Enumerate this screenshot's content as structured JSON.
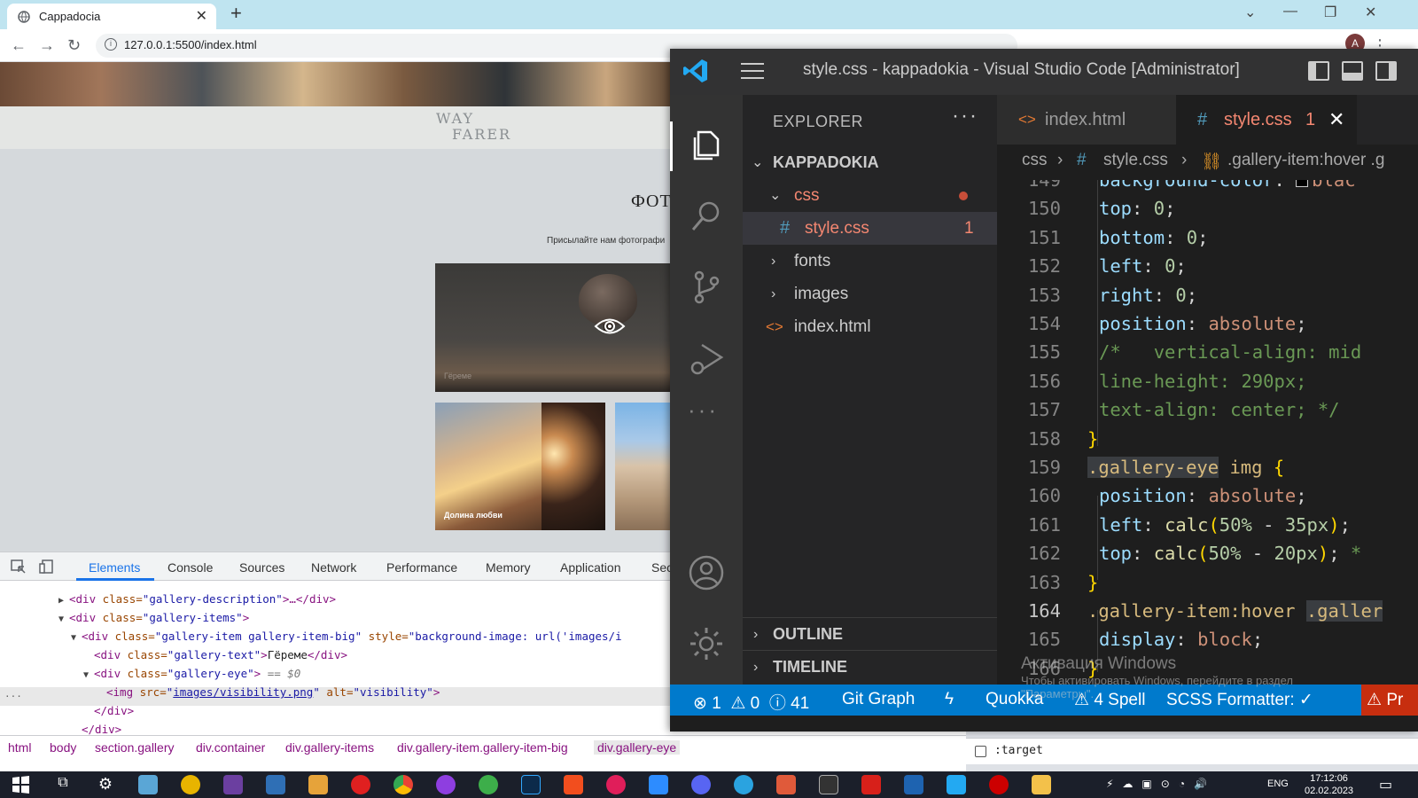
{
  "browser": {
    "tab_title": "Cappadocia",
    "url": "127.0.0.1:5500/index.html"
  },
  "webpage": {
    "logo_line1": "WAY",
    "logo_line2": "FARER",
    "gallery_title": "ФОТ",
    "gallery_description": "Присылайте нам фотографи",
    "big_image_caption": "Гёреме",
    "small_image1_caption": "Долина любви"
  },
  "devtools": {
    "tabs": [
      "Elements",
      "Console",
      "Sources",
      "Network",
      "Performance",
      "Memory",
      "Application",
      "Sec"
    ],
    "active_tab": "Elements",
    "dom": {
      "l1_tag_open": "<div",
      "l1_attr": " class=",
      "l1_val": "\"gallery-description\"",
      "l1_rest": ">…</div>",
      "l2_tag_open": "<div",
      "l2_attr": " class=",
      "l2_val": "\"gallery-items\"",
      "l2_rest": ">",
      "l3_tag_open": "<div",
      "l3_attr": " class=",
      "l3_val": "\"gallery-item gallery-item-big\"",
      "l3_attr2": " style=",
      "l3_val2": "\"background-image: url('images/i",
      "l4_tag_open": "<div",
      "l4_attr": " class=",
      "l4_val": "\"gallery-text\"",
      "l4_gt": ">",
      "l4_text": "Гёреме",
      "l4_close": "</div>",
      "l5_tag_open": "<div",
      "l5_attr": " class=",
      "l5_val": "\"gallery-eye\"",
      "l5_gt": ">",
      "l5_eq": " == $0",
      "l6_tag_open": "<img",
      "l6_attr": " src=",
      "l6_quote": "\"",
      "l6_link": "images/visibility.png",
      "l6_attr2": " alt=",
      "l6_val2": "\"visibility\"",
      "l6_gt": ">",
      "l7": "</div>",
      "l8": "</div>"
    },
    "breadcrumbs": [
      "html",
      "body",
      "section.gallery",
      "div.container",
      "div.gallery-items",
      "div.gallery-item.gallery-item-big",
      "div.gallery-eye"
    ],
    "styles_pseudo": ":target"
  },
  "vscode": {
    "title": "style.css - kappadokia - Visual Studio Code [Administrator]",
    "explorer": {
      "title": "EXPLORER",
      "more": "···",
      "root": "KAPPADOKIA",
      "css_folder": "css",
      "style_file": "style.css",
      "style_file_errors": "1",
      "fonts_folder": "fonts",
      "images_folder": "images",
      "index_file": "index.html",
      "outline": "OUTLINE",
      "timeline": "TIMELINE"
    },
    "tabs": {
      "index": "index.html",
      "style": "style.css",
      "style_errors": "1"
    },
    "breadcrumb": {
      "folder": "css",
      "file": "style.css",
      "symbol": ".gallery-item:hover .g"
    },
    "code": {
      "ln149": "149",
      "l149_prop": "background-color",
      "l149_rest": ": ",
      "l149_val": "blac",
      "ln150": "150",
      "l150_prop": "top",
      "l150_val": "0",
      "ln151": "151",
      "l151_prop": "bottom",
      "l151_val": "0",
      "ln152": "152",
      "l152_prop": "left",
      "l152_val": "0",
      "ln153": "153",
      "l153_prop": "right",
      "l153_val": "0",
      "ln154": "154",
      "l154_prop": "position",
      "l154_val": "absolute",
      "ln155": "155",
      "l155_text": "/*   vertical-align: mid",
      "ln156": "156",
      "l156_text": "line-height: 290px;",
      "ln157": "157",
      "l157_text": "text-align: center; */",
      "ln158": "158",
      "l158_text": "}",
      "ln159": "159",
      "l159_sel": ".gallery-eye",
      "l159_tag": " img ",
      "l159_brace": "{",
      "ln160": "160",
      "l160_prop": "position",
      "l160_val": "absolute",
      "ln161": "161",
      "l161_prop": "left",
      "l161_fn": "calc",
      "l161_a": "50%",
      "l161_op": " - ",
      "l161_b": "35px",
      "ln162": "162",
      "l162_prop": "top",
      "l162_fn": "calc",
      "l162_a": "50%",
      "l162_op": " - ",
      "l162_b": "20px",
      "l162_tail": " *",
      "ln163": "163",
      "l163_text": "}",
      "ln164": "164",
      "l164_sel": ".gallery-item:hover",
      "l164_sel2": ".galler",
      "ln165": "165",
      "l165_prop": "display",
      "l165_val": "block",
      "ln166": "166",
      "l166_text": "}"
    },
    "status": {
      "errors": "1",
      "warnings": "0",
      "infos": "41",
      "git_graph": "Git Graph",
      "quokka": "Quokka",
      "spell": "4 Spell",
      "scss": "SCSS Formatter: ✓",
      "problem": "Pr"
    },
    "watermark_title": "Активация Windows",
    "watermark_line1": "Чтобы активировать Windows, перейдите в раздел",
    "watermark_line2": "\"Параметры\"."
  },
  "taskbar": {
    "lang": "ENG",
    "time": "17:12:06",
    "date": "02.02.2023"
  },
  "colors": {
    "vscode_accent": "#007acc",
    "error_red": "#c72e0f",
    "devtools_blue": "#1a73e8"
  }
}
